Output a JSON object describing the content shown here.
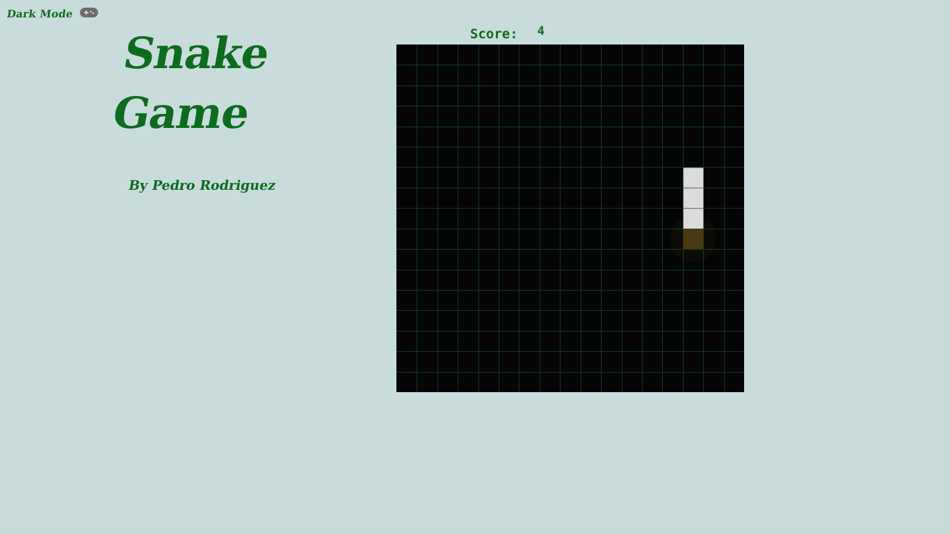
{
  "header": {
    "dark_mode_label": "Dark Mode"
  },
  "title": {
    "line1": "Snake",
    "line2": "Game"
  },
  "author": "By Pedro Rodriguez",
  "score": {
    "label": "Score:",
    "value": "4"
  },
  "board": {
    "cols": 17,
    "rows": 17,
    "snake": [
      [
        14,
        6
      ],
      [
        14,
        7
      ],
      [
        14,
        8
      ]
    ],
    "food": [
      14,
      9
    ],
    "colors": {
      "background": "#050507",
      "grid": "#0f3d16",
      "snake": "#dcdcdc",
      "food": "#4a3a14",
      "text": "#0d6b1f"
    }
  },
  "icons": {
    "toggle": "gamepad-icon"
  }
}
